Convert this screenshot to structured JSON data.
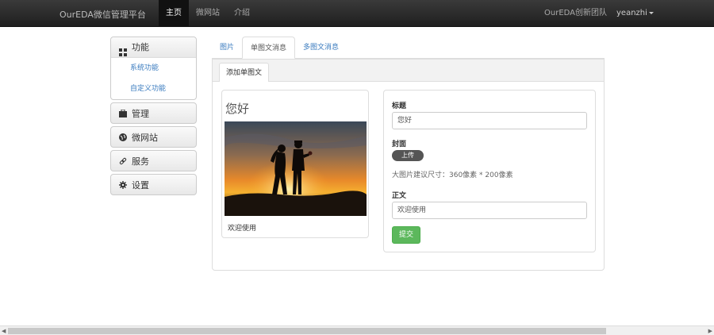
{
  "topbar": {
    "brand": "OurEDA微信管理平台",
    "nav": [
      "主页",
      "微网站",
      "介绍"
    ],
    "active_nav": 0,
    "team": "OurEDA创新团队",
    "user": "yeanzhi"
  },
  "sidebar": {
    "function_group": {
      "label": "功能",
      "items": [
        "系统功能",
        "自定义功能"
      ]
    },
    "items": [
      "管理",
      "微网站",
      "服务",
      "设置"
    ]
  },
  "tabs": [
    "图片",
    "单图文消息",
    "多图文消息"
  ],
  "active_tab": 1,
  "panel_tab": "添加单图文",
  "preview": {
    "title": "您好",
    "text": "欢迎使用"
  },
  "form": {
    "title_label": "标题",
    "title_value": "您好",
    "cover_label": "封面",
    "upload_label": "上传",
    "hint": "大图片建议尺寸：360像素 * 200像素",
    "body_label": "正文",
    "body_value": "欢迎使用",
    "submit_label": "提交"
  }
}
